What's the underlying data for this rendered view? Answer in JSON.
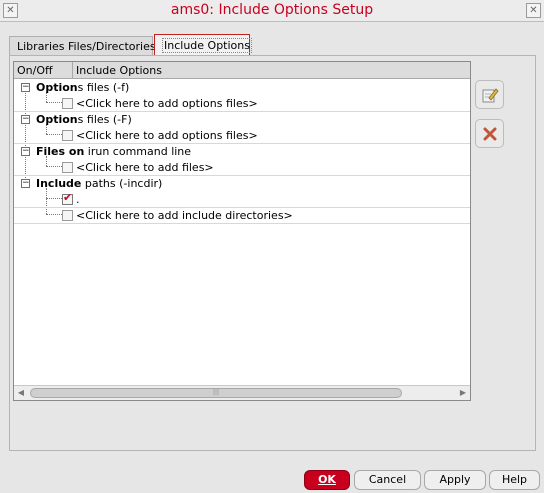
{
  "window": {
    "title": "ams0: Include Options Setup",
    "left_btn_icon": "window-menu-icon",
    "close_icon": "close-icon"
  },
  "tabs": [
    {
      "label": "Libraries Files/Directories",
      "active": false
    },
    {
      "label": "Include Options",
      "active": true
    }
  ],
  "table": {
    "col_onoff": "On/Off",
    "col_options": "Include Options",
    "groups": [
      {
        "bold": "Option",
        "rest": "s files (-f)",
        "child": {
          "label": "<Click here to add options files>",
          "checked": false
        }
      },
      {
        "bold": "Option",
        "rest": "s files (-F)",
        "child": {
          "label": "<Click here to add options files>",
          "checked": false
        }
      },
      {
        "bold": "Files on",
        "rest": " irun command line",
        "child": {
          "label": "<Click here to add files>",
          "checked": false
        }
      },
      {
        "bold": "Include",
        "rest": " paths (-incdir)",
        "children": [
          {
            "label": ".",
            "checked": true
          },
          {
            "label": "<Click here to add include directories>",
            "checked": false
          }
        ]
      }
    ]
  },
  "side_buttons": [
    {
      "icon": "edit-icon"
    },
    {
      "icon": "delete-icon"
    }
  ],
  "buttons": {
    "ok": "OK",
    "cancel": "Cancel",
    "apply": "Apply",
    "help": "Help"
  },
  "colors": {
    "accent": "#c8001e"
  }
}
